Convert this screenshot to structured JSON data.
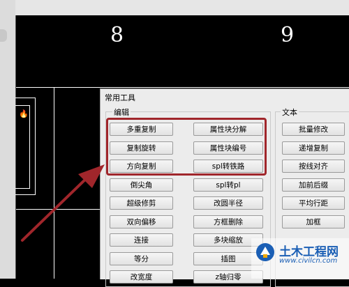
{
  "cad": {
    "grid_labels": [
      "8",
      "9"
    ]
  },
  "dialog": {
    "title": "常用工具",
    "groups": {
      "edit": {
        "label": "编辑",
        "col1": [
          "多重复制",
          "复制旋转",
          "方向复制",
          "倒尖角",
          "超级修剪",
          "双向偏移",
          "连接",
          "等分",
          "改宽度"
        ],
        "col2": [
          "属性块分解",
          "属性块编号",
          "spl转铁路",
          "spl转pl",
          "改圆半径",
          "方框删除",
          "多块缩放",
          "插图",
          "z轴归零"
        ]
      },
      "text": {
        "label": "文本",
        "buttons": [
          "批量修改",
          "递增复制",
          "按线对齐",
          "加前后缀",
          "平均行距",
          "加框"
        ]
      }
    }
  },
  "annotation": {
    "highlight_color": "#a0262b",
    "arrow_color": "#a0262b"
  },
  "watermark": {
    "title": "土木工程网",
    "url": "www.civilcn.com"
  }
}
